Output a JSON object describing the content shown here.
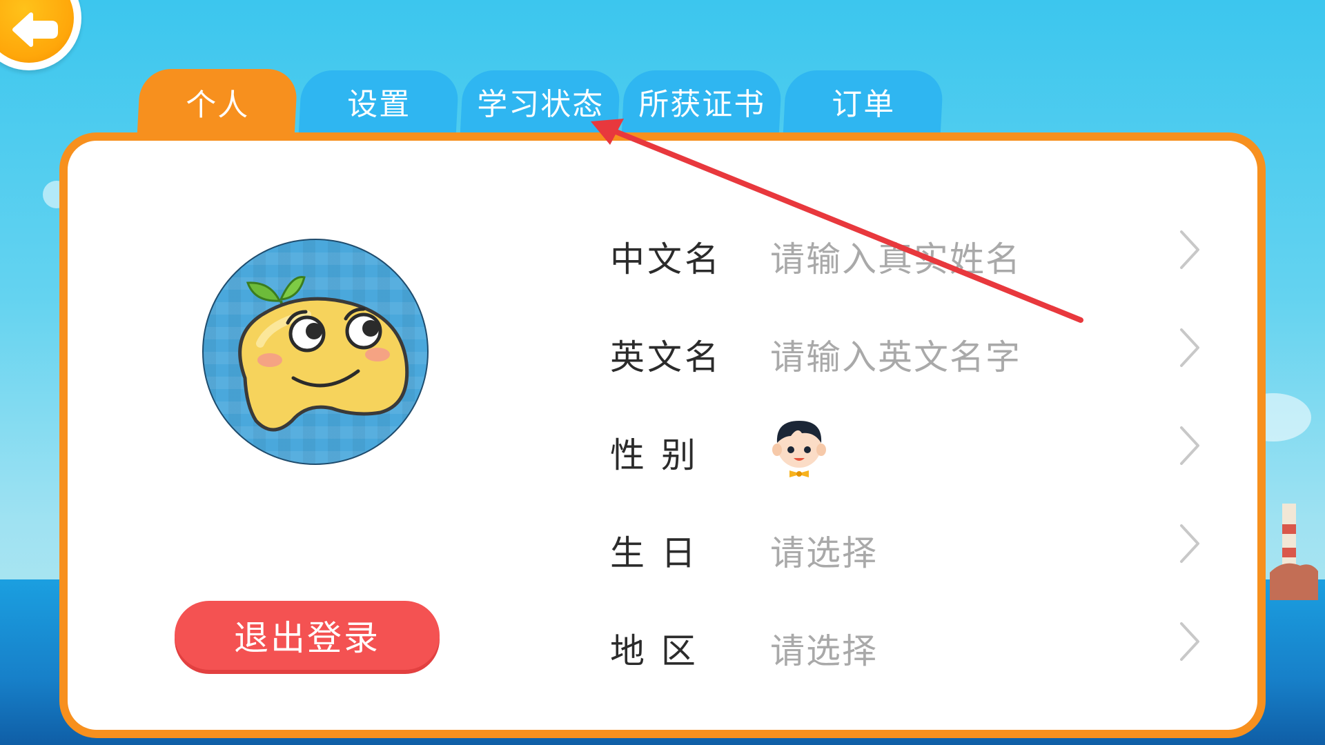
{
  "tabs": [
    {
      "label": "个人",
      "active": true
    },
    {
      "label": "设置",
      "active": false
    },
    {
      "label": "学习状态",
      "active": false
    },
    {
      "label": "所获证书",
      "active": false
    },
    {
      "label": "订单",
      "active": false
    }
  ],
  "back_icon": "back-arrow-icon",
  "profile": {
    "avatar_icon": "bean-mascot-avatar",
    "logout_label": "退出登录"
  },
  "fields": {
    "chinese_name": {
      "label": "中文名",
      "placeholder": "请输入真实姓名"
    },
    "english_name": {
      "label": "英文名",
      "placeholder": "请输入英文名字"
    },
    "gender": {
      "label": "性 别",
      "icon": "boy-icon"
    },
    "birthday": {
      "label": "生 日",
      "placeholder": "请选择"
    },
    "region": {
      "label": "地 区",
      "placeholder": "请选择"
    }
  },
  "colors": {
    "accent_orange": "#f7901e",
    "tab_blue": "#2fb6f1",
    "logout_red": "#f45252",
    "annotation_red": "#e8383d"
  }
}
